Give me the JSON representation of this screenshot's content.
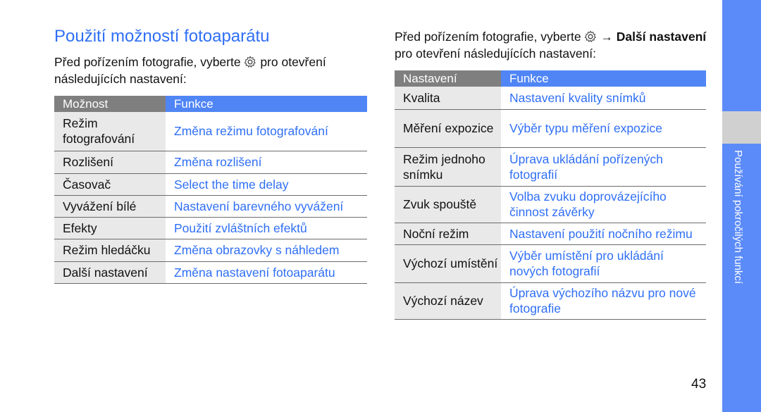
{
  "title": "Použití možností fotoaparátu",
  "left": {
    "intro_before": "Před pořízením fotografie, vyberte",
    "intro_after": "pro otevření následujících nastavení:",
    "headers": [
      "Možnost",
      "Funkce"
    ],
    "rows": [
      {
        "k": "Režim fotografování",
        "v": "Změna režimu fotografování"
      },
      {
        "k": "Rozlišení",
        "v": "Změna rozlišení"
      },
      {
        "k": "Časovač",
        "v": "Select the time delay"
      },
      {
        "k": "Vyvážení bílé",
        "v": "Nastavení barevného vyvážení"
      },
      {
        "k": "Efekty",
        "v": "Použití zvláštních efektů"
      },
      {
        "k": "Režim hledáčku",
        "v": "Změna obrazovky s náhledem"
      },
      {
        "k": "Další nastavení",
        "v": "Změna nastavení fotoaparátu"
      }
    ]
  },
  "right": {
    "intro_before": "Před pořízením fotografie, vyberte",
    "arrow": "→",
    "intro_bold": "Další nastavení",
    "intro_after": "pro otevření následujících nastavení:",
    "headers": [
      "Nastavení",
      "Funkce"
    ],
    "rows": [
      {
        "k": "Kvalita",
        "v": "Nastavení kvality snímků"
      },
      {
        "k": "Měření expozice",
        "v": "Výběr typu měření expozice"
      },
      {
        "k": "Režim jednoho snímku",
        "v": "Úprava ukládání pořízených fotografií"
      },
      {
        "k": "Zvuk spouště",
        "v": "Volba zvuku doprovázejícího činnost závěrky"
      },
      {
        "k": "Noční režim",
        "v": "Nastavení použití nočního režimu"
      },
      {
        "k": "Výchozí umístění",
        "v": "Výběr umístění pro ukládání nových fotografií"
      },
      {
        "k": "Výchozí název",
        "v": "Úprava výchozího názvu pro nové fotografie"
      }
    ]
  },
  "side_tab": "Používání pokročilých funkcí",
  "page_number": "43",
  "icons": {
    "settings": "gear-icon"
  },
  "colors": {
    "accent": "#2f6ff5",
    "header_blue": "#5085f5",
    "header_gray": "#7f7f7f",
    "tab": "#5b8bf8"
  }
}
